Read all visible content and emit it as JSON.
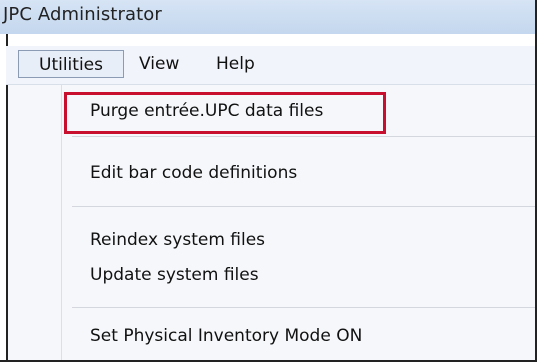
{
  "window": {
    "title": "JPC Administrator"
  },
  "menubar": {
    "items": [
      {
        "label": "Utilities"
      },
      {
        "label": "View"
      },
      {
        "label": "Help"
      }
    ]
  },
  "utilities_menu": {
    "items": [
      {
        "label": "Purge entrée.UPC data files"
      },
      {
        "label": "Edit bar code definitions"
      },
      {
        "label": "Reindex system files"
      },
      {
        "label": "Update system files"
      },
      {
        "label": "Set Physical Inventory Mode ON"
      }
    ]
  },
  "colors": {
    "highlight_border": "#c8102e",
    "title_bar": "#c4d7ee",
    "menu_bar": "#f1f5fb",
    "menu_background": "#f5f7fa"
  }
}
